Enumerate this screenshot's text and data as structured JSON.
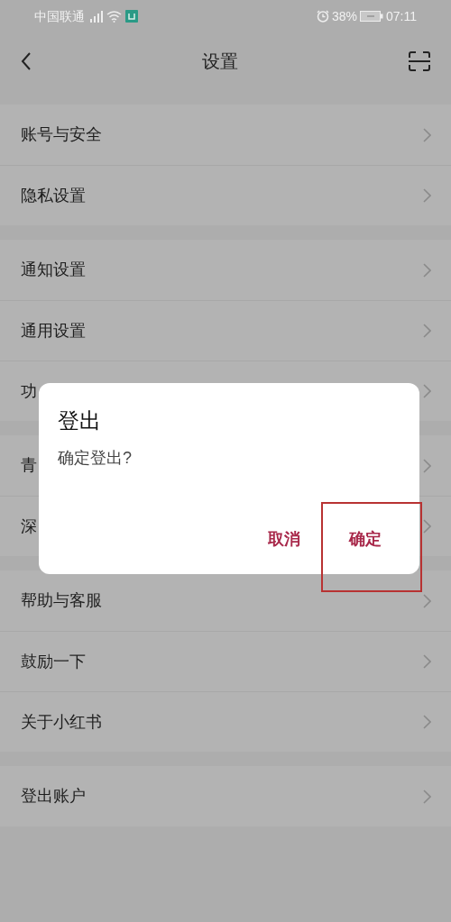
{
  "status_bar": {
    "carrier": "中国联通",
    "battery": "38%",
    "time": "07:11"
  },
  "header": {
    "title": "设置"
  },
  "groups": [
    {
      "items": [
        {
          "label": "账号与安全"
        },
        {
          "label": "隐私设置"
        }
      ]
    },
    {
      "items": [
        {
          "label": "通知设置"
        },
        {
          "label": "通用设置"
        },
        {
          "label": "功"
        }
      ]
    },
    {
      "items": [
        {
          "label": "青"
        },
        {
          "label": "深"
        }
      ]
    },
    {
      "items": [
        {
          "label": "帮助与客服"
        },
        {
          "label": "鼓励一下"
        },
        {
          "label": "关于小红书"
        }
      ]
    },
    {
      "items": [
        {
          "label": "登出账户"
        }
      ]
    }
  ],
  "dialog": {
    "title": "登出",
    "message": "确定登出?",
    "buttons": [
      {
        "label": "取消",
        "annotated": false
      },
      {
        "label": "确定",
        "annotated": true
      }
    ]
  }
}
